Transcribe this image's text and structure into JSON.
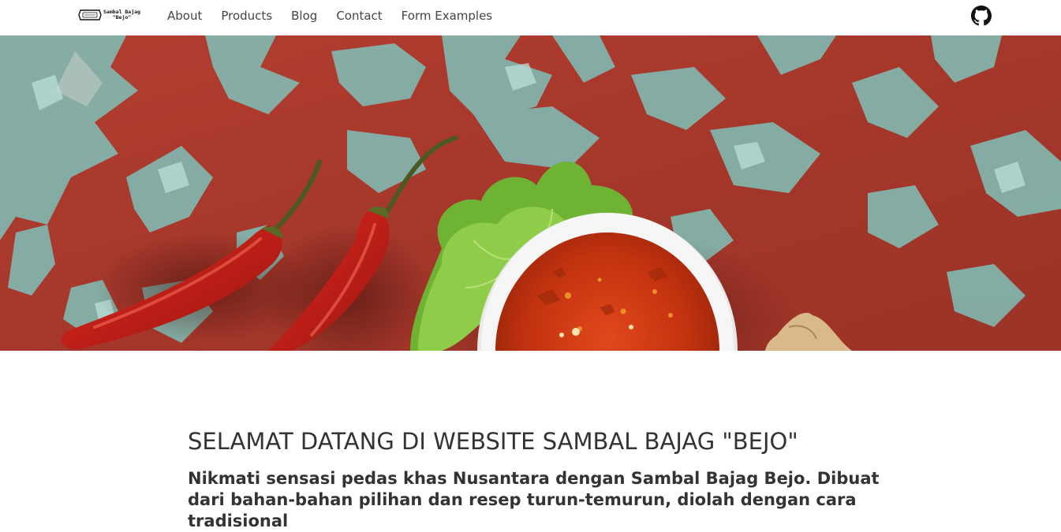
{
  "navbar": {
    "logo": {
      "line1": "Sambal Bajag",
      "line2": "\"Bejo\""
    },
    "links": [
      {
        "label": "About"
      },
      {
        "label": "Products"
      },
      {
        "label": "Blog"
      },
      {
        "label": "Contact"
      },
      {
        "label": "Form Examples"
      }
    ],
    "github_icon": "github-icon"
  },
  "hero": {
    "image": "chili-sambal-photo",
    "colors": {
      "background_red": "#a8382c",
      "background_teal": "#7fc1b9",
      "chili": "#c8201a",
      "lettuce": "#7dbf3a",
      "bowl": "#f2f2f2",
      "sambal": "#c93a17"
    }
  },
  "main": {
    "title": "SELAMAT DATANG DI WEBSITE SAMBAL BAJAG \"BEJO\"",
    "intro": "Nikmati sensasi pedas khas Nusantara dengan Sambal Bajag Bejo. Dibuat dari bahan-bahan pilihan dan resep turun-temurun, diolah dengan cara tradisional"
  }
}
